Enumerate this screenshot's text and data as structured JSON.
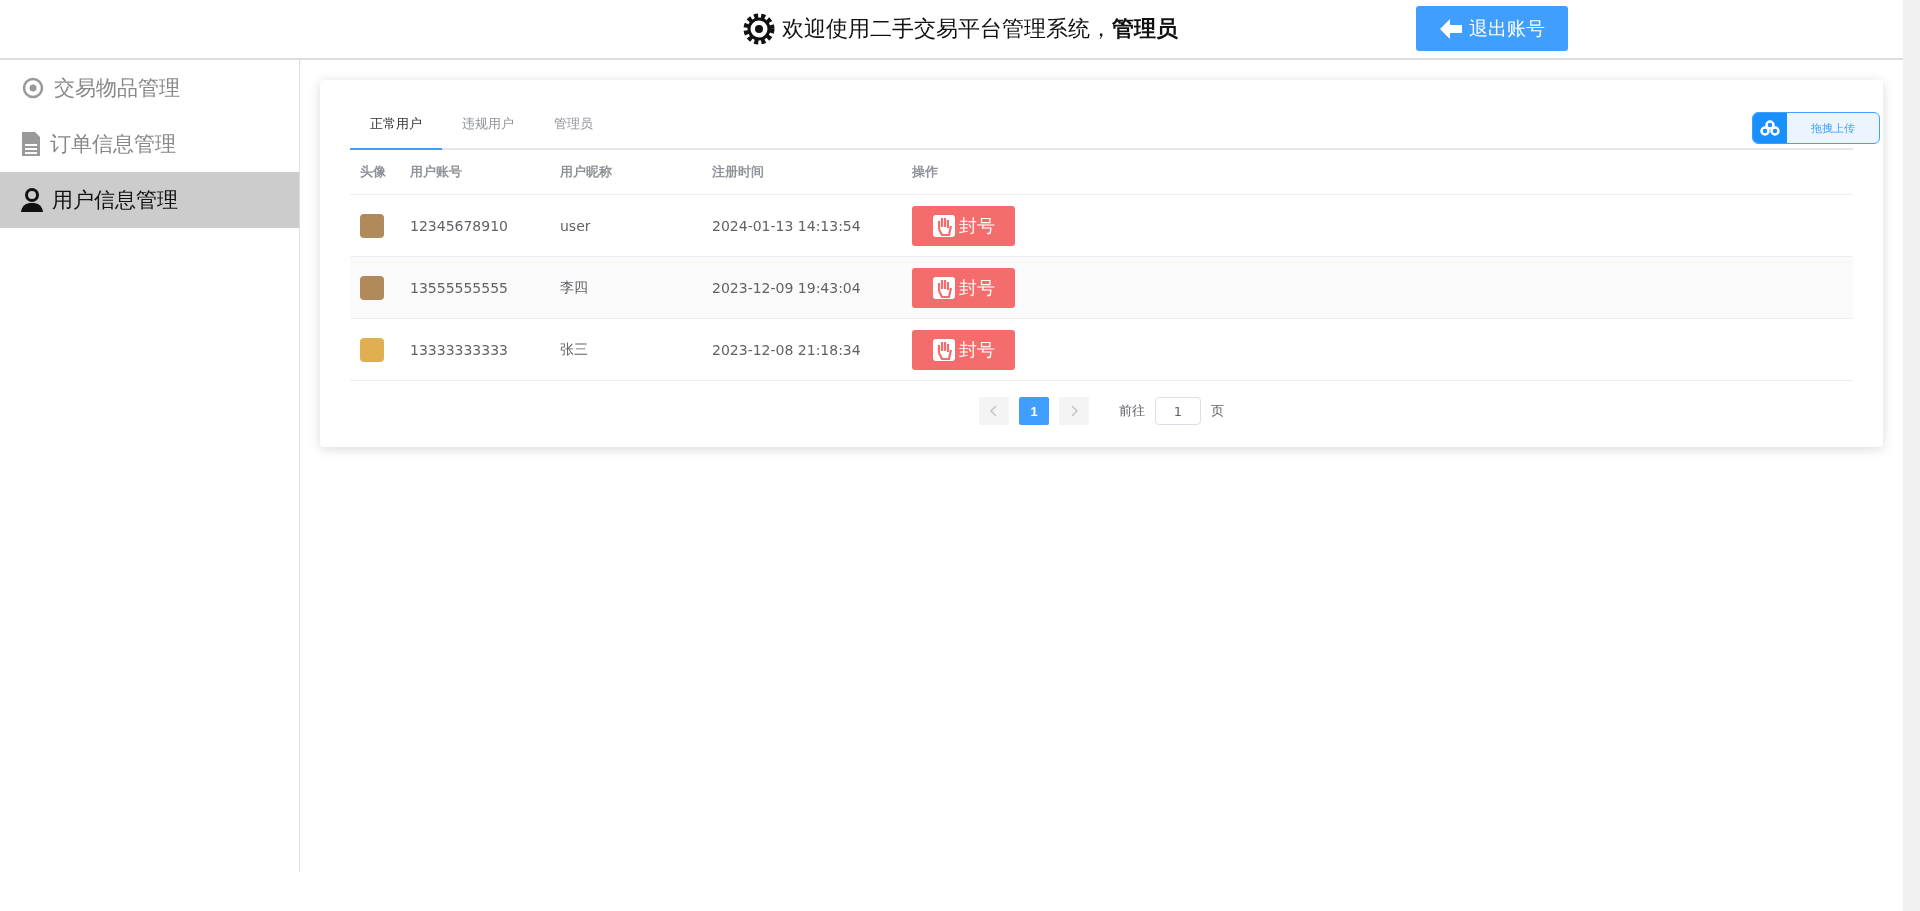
{
  "header": {
    "welcome": "欢迎使用二手交易平台管理系统，",
    "role": "管理员",
    "logout": "退出账号"
  },
  "sidebar": {
    "items": [
      {
        "label": "交易物品管理",
        "kind": "goods",
        "selected": false
      },
      {
        "label": "订单信息管理",
        "kind": "orders",
        "selected": false
      },
      {
        "label": "用户信息管理",
        "kind": "users",
        "selected": true
      }
    ]
  },
  "tabs": [
    {
      "label": "正常用户",
      "selected": true
    },
    {
      "label": "违规用户",
      "selected": false
    },
    {
      "label": "管理员",
      "selected": false
    }
  ],
  "upload": {
    "label": "拖拽上传"
  },
  "table": {
    "columns": [
      "头像",
      "用户账号",
      "用户昵称",
      "注册时间",
      "操作"
    ],
    "rows": [
      {
        "account": "12345678910",
        "nickname": "user",
        "registered": "2024-01-13 14:13:54",
        "action": "封号"
      },
      {
        "account": "13555555555",
        "nickname": "李四",
        "registered": "2023-12-09 19:43:04",
        "action": "封号"
      },
      {
        "account": "13333333333",
        "nickname": "张三",
        "registered": "2023-12-08 21:18:34",
        "action": "封号"
      }
    ]
  },
  "pagination": {
    "pages": [
      {
        "label": "1",
        "selected": true
      }
    ],
    "goto_label": "前往",
    "goto_value": "1",
    "page_suffix": "页"
  }
}
